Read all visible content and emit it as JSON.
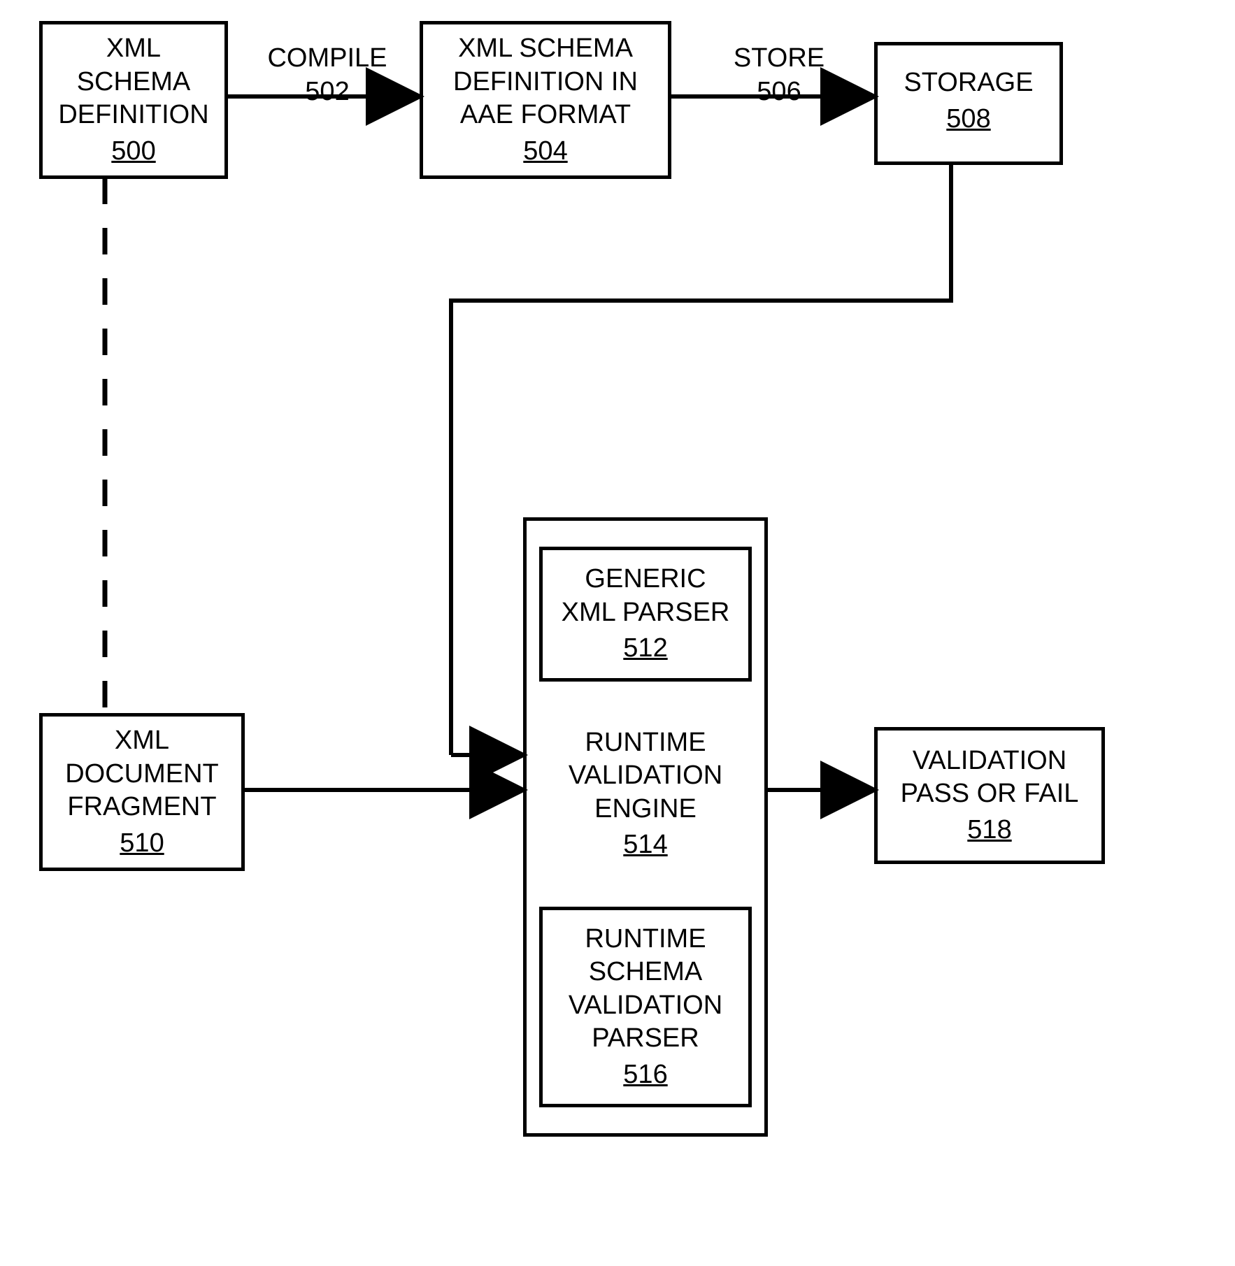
{
  "nodes": {
    "xml_schema_def": {
      "label": "XML\nSCHEMA\nDEFINITION",
      "ref": "500"
    },
    "compile_edge": {
      "label": "COMPILE",
      "ref": "502"
    },
    "xml_schema_aae": {
      "label": "XML SCHEMA\nDEFINITION IN\nAAE FORMAT",
      "ref": "504"
    },
    "store_edge": {
      "label": "STORE",
      "ref": "506"
    },
    "storage": {
      "label": "STORAGE",
      "ref": "508"
    },
    "xml_doc_fragment": {
      "label": "XML\nDOCUMENT\nFRAGMENT",
      "ref": "510"
    },
    "generic_parser": {
      "label": "GENERIC\nXML PARSER",
      "ref": "512"
    },
    "runtime_engine": {
      "label": "RUNTIME\nVALIDATION\nENGINE",
      "ref": "514"
    },
    "runtime_schema_parser": {
      "label": "RUNTIME\nSCHEMA\nVALIDATION\nPARSER",
      "ref": "516"
    },
    "validation_result": {
      "label": "VALIDATION\nPASS OR FAIL",
      "ref": "518"
    }
  }
}
